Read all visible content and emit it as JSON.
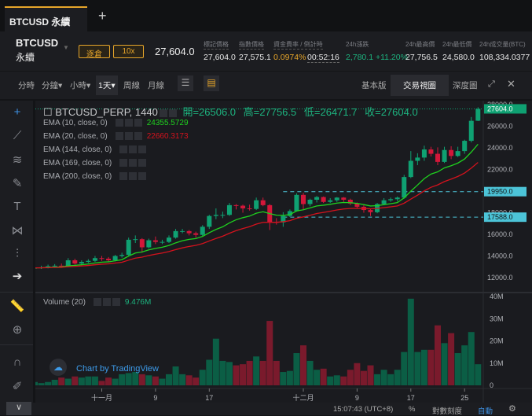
{
  "tabs": [
    {
      "label": "BTCUSD 永續"
    }
  ],
  "new_tab_icon": "plus-icon",
  "header": {
    "symbol": "BTCUSD",
    "symbol_sub": "永續",
    "margin_mode": "逐倉",
    "leverage": "10x",
    "last_price": "27,604.0",
    "stats": [
      {
        "label": "標記價格",
        "value": "27,604.0"
      },
      {
        "label": "指數價格",
        "value": "27,575.1"
      },
      {
        "label": "資金費率 / 倒計時",
        "value": "0.0974%",
        "value2": "00:52:16"
      },
      {
        "label": "24h漲跌",
        "value": "2,780.1 +11.20%"
      },
      {
        "label": "24h最高價",
        "value": "27,756.5"
      },
      {
        "label": "24h最低價",
        "value": "24,580.0"
      },
      {
        "label": "24h成交量(BTC)",
        "value": "108,334.0377"
      }
    ]
  },
  "toolbar": {
    "intervals": [
      "分時",
      "分鐘▾",
      "小時▾",
      "1天▾",
      "周線",
      "月線"
    ],
    "active_interval": "1天▾",
    "views": [
      "基本版",
      "交易視圖",
      "深度圖"
    ],
    "active_view": "交易視圖"
  },
  "chart": {
    "title": "BTCUSD_PERP, 1440",
    "ohlc": {
      "open": "開=26506.0",
      "high": "高=27756.5",
      "low": "低=26471.7",
      "close": "收=27604.0"
    },
    "indicators": [
      {
        "label": "EMA (10, close, 0)",
        "value": "24355.5729",
        "color": "#1fd11f"
      },
      {
        "label": "EMA (20, close, 0)",
        "value": "22660.3173",
        "color": "#d4121d"
      },
      {
        "label": "EMA (144, close, 0)"
      },
      {
        "label": "EMA (169, close, 0)"
      },
      {
        "label": "EMA (200, close, 0)"
      }
    ],
    "volume_label": "Volume (20)",
    "volume_value": "9.476M",
    "watermark": "Chart by TradingView",
    "price_ticks": [
      "28000.0",
      "26000.0",
      "24000.0",
      "22000.0",
      "20000.0",
      "18000.0",
      "16000.0",
      "14000.0",
      "12000.0"
    ],
    "price_labels": [
      {
        "value": "27604.0",
        "color": "#0fa172"
      },
      {
        "value": "19950.0",
        "color": "#4cc4d8"
      },
      {
        "value": "17588.0",
        "color": "#4cc4d8"
      }
    ],
    "volume_ticks": [
      "40M",
      "30M",
      "20M",
      "10M",
      "0"
    ],
    "date_ticks": [
      {
        "label": "十一月",
        "index": 10
      },
      {
        "label": "9",
        "index": 18
      },
      {
        "label": "17",
        "index": 26
      },
      {
        "label": "十二月",
        "index": 40
      },
      {
        "label": "9",
        "index": 48
      },
      {
        "label": "17",
        "index": 56
      },
      {
        "label": "25",
        "index": 64
      }
    ],
    "colors": {
      "up": "#0fa172",
      "down": "#d4173a",
      "vol_up": "#0b5e45",
      "vol_down": "#7a1a2c",
      "hline": "#4cc4d8"
    }
  },
  "chart_data": {
    "type": "candlestick",
    "start": "Oct 22",
    "end": "Dec 27",
    "ylim": [
      11500,
      28500
    ],
    "hlines": [
      19950,
      17588
    ],
    "volume_unit": "M",
    "open": [
      12850,
      12900,
      12950,
      13050,
      13100,
      13050,
      13600,
      13300,
      13450,
      13550,
      13800,
      13750,
      13600,
      14000,
      14100,
      15500,
      15550,
      14800,
      15450,
      15300,
      15300,
      15700,
      16300,
      16300,
      16100,
      15950,
      16700,
      17700,
      17800,
      17800,
      18700,
      18650,
      18400,
      18350,
      19150,
      18700,
      17150,
      17100,
      17700,
      18150,
      19650,
      18800,
      19200,
      19450,
      19000,
      19150,
      19400,
      19200,
      18850,
      18550,
      18250,
      18050,
      18800,
      19150,
      19250,
      19400,
      21300,
      22800,
      23100,
      23850,
      23450,
      22700,
      23800,
      23250,
      23700,
      24650,
      26506
    ],
    "high": [
      13050,
      13100,
      13200,
      13250,
      13300,
      13800,
      13750,
      13600,
      13700,
      14000,
      14000,
      13900,
      14100,
      14300,
      15700,
      15900,
      15650,
      15600,
      15800,
      15500,
      15900,
      16500,
      16500,
      16400,
      16250,
      16850,
      17800,
      18400,
      18100,
      18900,
      18800,
      18750,
      18750,
      19400,
      19400,
      18800,
      17500,
      18050,
      18300,
      19800,
      19850,
      19300,
      19550,
      19500,
      19350,
      19450,
      19450,
      19300,
      18950,
      18700,
      18350,
      18900,
      19350,
      19400,
      19500,
      21500,
      23700,
      23500,
      24200,
      24100,
      24050,
      24100,
      24150,
      24100,
      24750,
      26850,
      27756.5
    ],
    "low": [
      12750,
      12800,
      12850,
      12950,
      12900,
      12950,
      13200,
      13150,
      13350,
      13450,
      13550,
      13450,
      13500,
      13850,
      14000,
      15200,
      14300,
      14700,
      15100,
      15100,
      15200,
      15600,
      16100,
      15900,
      15700,
      15850,
      16500,
      17400,
      17500,
      17700,
      18300,
      18000,
      18200,
      18250,
      18600,
      16400,
      16900,
      16700,
      17600,
      18100,
      18300,
      18600,
      18950,
      18900,
      18900,
      19000,
      19000,
      18700,
      18400,
      18000,
      17700,
      17950,
      18700,
      19000,
      19050,
      19300,
      21200,
      22400,
      22800,
      23200,
      22400,
      22600,
      22950,
      23150,
      23450,
      24500,
      26471.7
    ],
    "close": [
      12900,
      12950,
      13050,
      13100,
      13050,
      13600,
      13300,
      13450,
      13550,
      13800,
      13750,
      13600,
      14000,
      14100,
      15500,
      15550,
      14800,
      15450,
      15300,
      15300,
      15700,
      16300,
      16300,
      16100,
      15950,
      16700,
      17700,
      17800,
      17800,
      18700,
      18650,
      18400,
      18350,
      19150,
      18700,
      17150,
      17100,
      17700,
      18150,
      19650,
      18800,
      19200,
      19450,
      19000,
      19150,
      19400,
      19200,
      18850,
      18550,
      18250,
      18050,
      18800,
      19150,
      19250,
      19400,
      21300,
      22800,
      23100,
      23850,
      23450,
      22700,
      23800,
      23250,
      23700,
      24650,
      26500,
      27604
    ],
    "volume": [
      1.5,
      1,
      1.5,
      2.5,
      3.5,
      3,
      4,
      3.5,
      4,
      4,
      2,
      3.5,
      3,
      5,
      5.5,
      6,
      5,
      4.5,
      4,
      3,
      5,
      8.5,
      5,
      4.5,
      3.5,
      7,
      11.5,
      21,
      11,
      10.5,
      9,
      9.5,
      11,
      13,
      11,
      29,
      11,
      6,
      6.5,
      14.5,
      18,
      11,
      7,
      7.5,
      4,
      4.5,
      4,
      7,
      10,
      6.5,
      9,
      5,
      7,
      5,
      7,
      15,
      39,
      15,
      16,
      16,
      27,
      19,
      23.5,
      14.5,
      18,
      24,
      9.5
    ]
  },
  "status": {
    "time": "15:07:43 (UTC+8)",
    "percent": "%",
    "log_scale": "對數刻度",
    "auto": "自動"
  }
}
